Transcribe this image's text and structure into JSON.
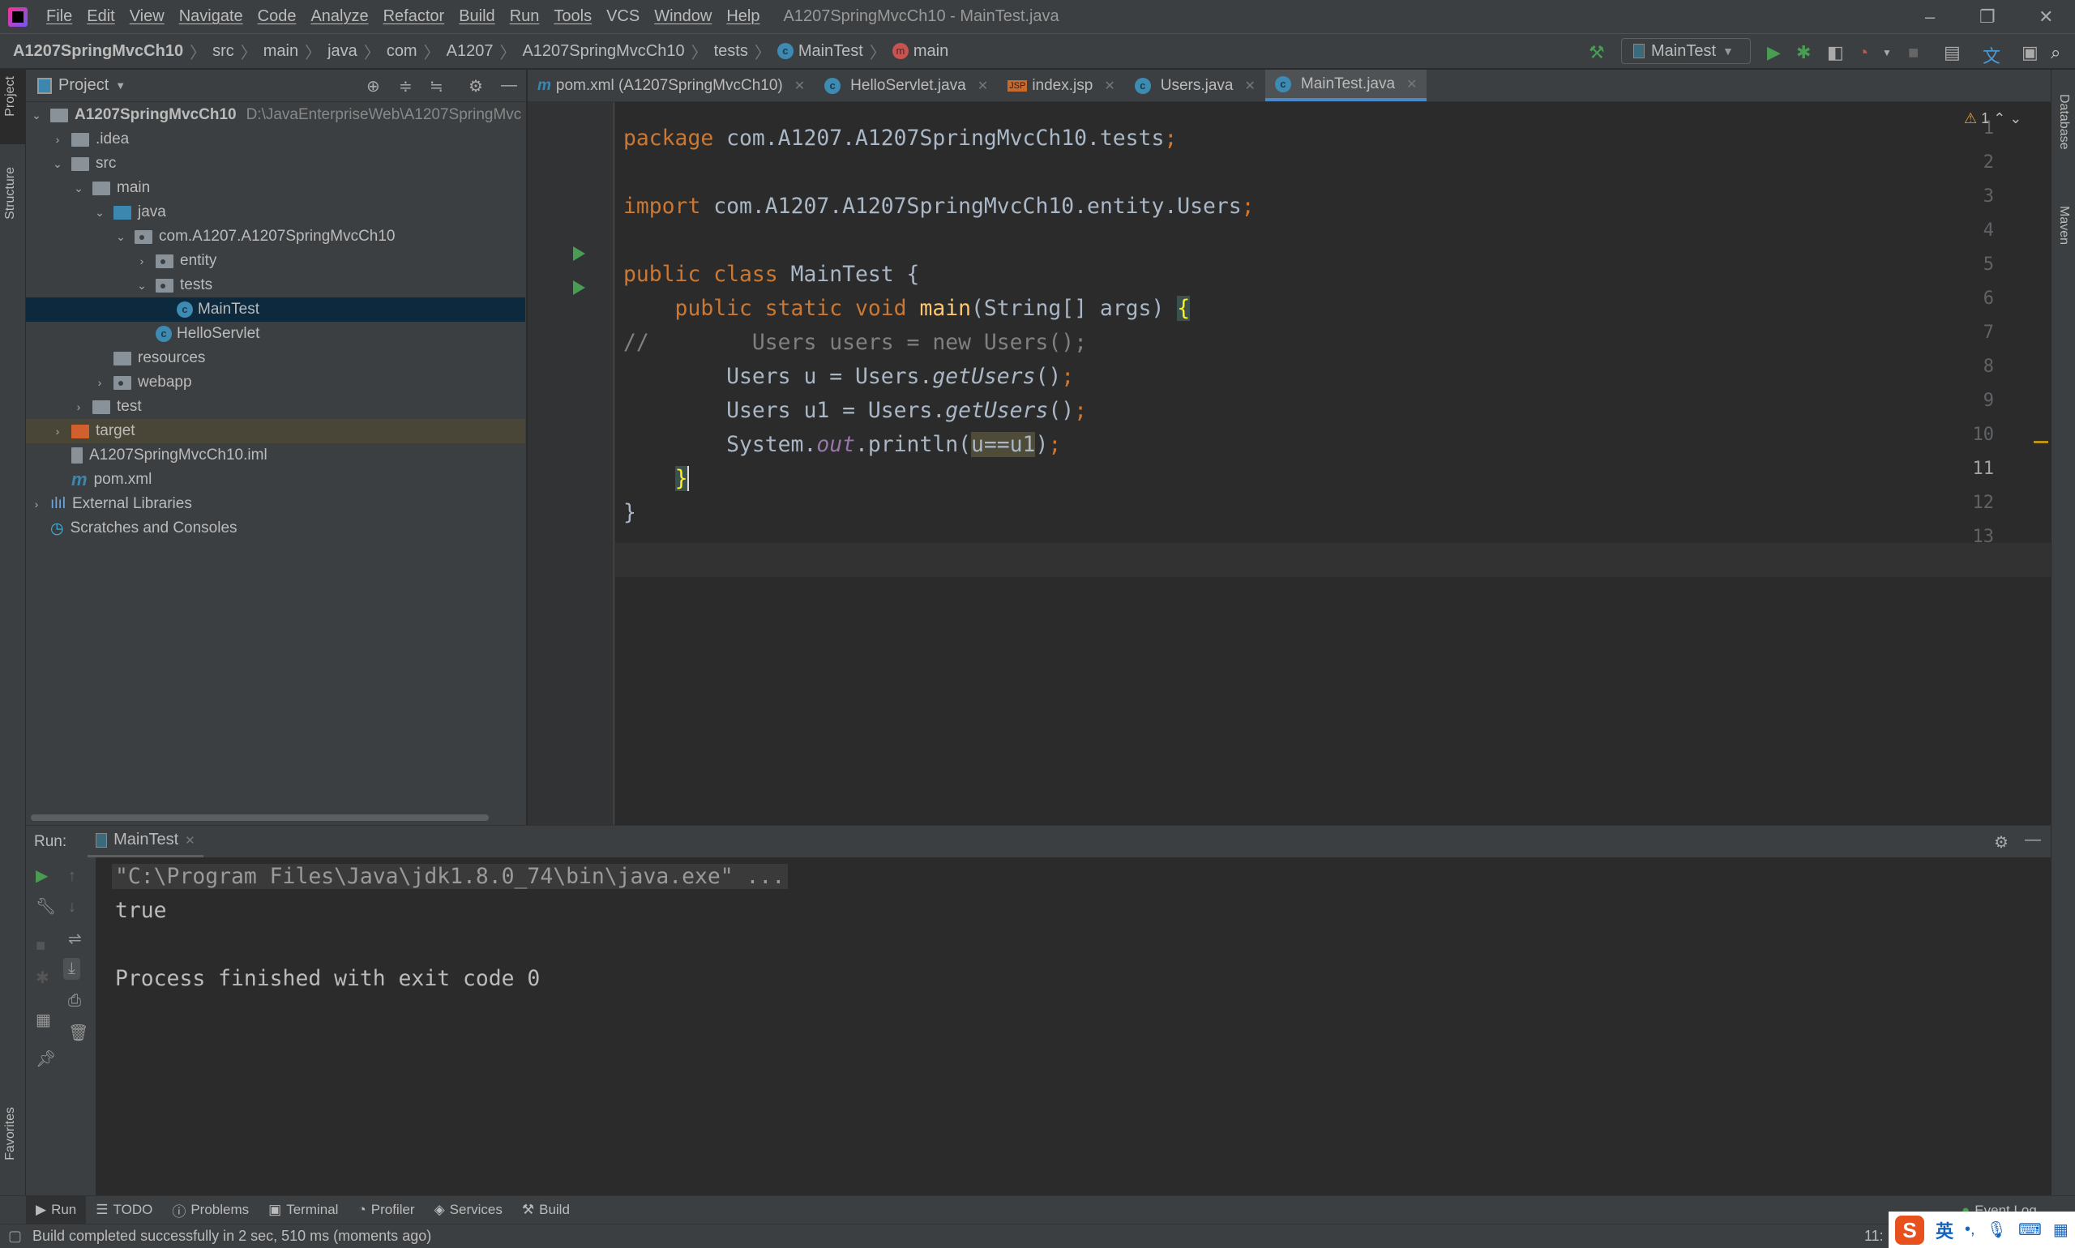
{
  "window": {
    "title": "A1207SpringMvcCh10 - MainTest.java"
  },
  "menu": [
    "File",
    "Edit",
    "View",
    "Navigate",
    "Code",
    "Analyze",
    "Refactor",
    "Build",
    "Run",
    "Tools",
    "VCS",
    "Window",
    "Help"
  ],
  "breadcrumb": [
    "A1207SpringMvcCh10",
    "src",
    "main",
    "java",
    "com",
    "A1207",
    "A1207SpringMvcCh10",
    "tests",
    "MainTest",
    "main"
  ],
  "toolbar": {
    "run_config": "MainTest"
  },
  "side_stripes": {
    "left": [
      "Project",
      "Structure",
      "Favorites"
    ],
    "right": [
      "Database",
      "Maven"
    ]
  },
  "project": {
    "header": "Project",
    "root_path": "D:\\JavaEnterpriseWeb\\A1207SpringMvc",
    "tree": [
      {
        "label": "A1207SpringMvcCh10",
        "depth": 0,
        "expanded": true,
        "icon": "module-folder"
      },
      {
        "label": ".idea",
        "depth": 1,
        "expanded": false,
        "icon": "folder"
      },
      {
        "label": "src",
        "depth": 1,
        "expanded": true,
        "icon": "folder"
      },
      {
        "label": "main",
        "depth": 2,
        "expanded": true,
        "icon": "folder"
      },
      {
        "label": "java",
        "depth": 3,
        "expanded": true,
        "icon": "source-folder"
      },
      {
        "label": "com.A1207.A1207SpringMvcCh10",
        "depth": 4,
        "expanded": true,
        "icon": "package"
      },
      {
        "label": "entity",
        "depth": 5,
        "expanded": false,
        "icon": "package"
      },
      {
        "label": "tests",
        "depth": 5,
        "expanded": true,
        "icon": "package"
      },
      {
        "label": "MainTest",
        "depth": 6,
        "icon": "class-runnable",
        "selected": true
      },
      {
        "label": "HelloServlet",
        "depth": 5,
        "icon": "class"
      },
      {
        "label": "resources",
        "depth": 3,
        "icon": "resources-folder"
      },
      {
        "label": "webapp",
        "depth": 3,
        "expanded": false,
        "icon": "web-folder"
      },
      {
        "label": "test",
        "depth": 2,
        "expanded": false,
        "icon": "folder"
      },
      {
        "label": "target",
        "depth": 1,
        "expanded": false,
        "icon": "excluded-folder",
        "excluded": true
      },
      {
        "label": "A1207SpringMvcCh10.iml",
        "depth": 1,
        "icon": "iml-file"
      },
      {
        "label": "pom.xml",
        "depth": 1,
        "icon": "maven-file"
      },
      {
        "label": "External Libraries",
        "depth": 0,
        "expanded": false,
        "icon": "libraries"
      },
      {
        "label": "Scratches and Consoles",
        "depth": 0,
        "icon": "scratches"
      }
    ]
  },
  "tabs": [
    {
      "label": "pom.xml (A1207SpringMvcCh10)",
      "icon": "maven"
    },
    {
      "label": "HelloServlet.java",
      "icon": "class"
    },
    {
      "label": "index.jsp",
      "icon": "jsp"
    },
    {
      "label": "Users.java",
      "icon": "class"
    },
    {
      "label": "MainTest.java",
      "icon": "class-runnable",
      "active": true
    }
  ],
  "editor": {
    "warnings": "1",
    "current_line": 11,
    "lines": [
      "1",
      "2",
      "3",
      "4",
      "5",
      "6",
      "7",
      "8",
      "9",
      "10",
      "11",
      "12",
      "13"
    ],
    "code": {
      "l1_kw": "package",
      "l1_rest": " com.A1207.A1207SpringMvcCh10.tests",
      "semi": ";",
      "l3_kw": "import",
      "l3_rest": " com.A1207.A1207SpringMvcCh10.entity.Users",
      "l5_kw": "public class",
      "l5_rest": " MainTest {",
      "l6_kw": "    public static void ",
      "l6_fn": "main",
      "l6_rest": "(String[] args) ",
      "open_brace": "{",
      "l7_comment": "//        Users users = new Users();",
      "l8_a": "        Users u = Users.",
      "l8_m": "getUsers",
      "l8_b": "()",
      "l9_a": "        Users u1 = Users.",
      "l9_m": "getUsers",
      "l9_b": "()",
      "l10_a": "        System.",
      "l10_f": "out",
      "l10_b": ".println(",
      "l10_h": "u==u1",
      "l10_c": ")",
      "l11_indent": "    ",
      "close_brace": "}",
      "l12": "}"
    }
  },
  "run": {
    "label": "Run:",
    "tab": "MainTest",
    "console": [
      "\"C:\\Program Files\\Java\\jdk1.8.0_74\\bin\\java.exe\" ...",
      "true",
      "",
      "Process finished with exit code 0"
    ]
  },
  "tool_windows": [
    "Run",
    "TODO",
    "Problems",
    "Terminal",
    "Profiler",
    "Services",
    "Build"
  ],
  "event_log": "Event Log",
  "status": {
    "message": "Build completed successfully in 2 sec, 510 ms (moments ago)",
    "time_partial": "11:"
  },
  "ime": {
    "lang": "英"
  }
}
